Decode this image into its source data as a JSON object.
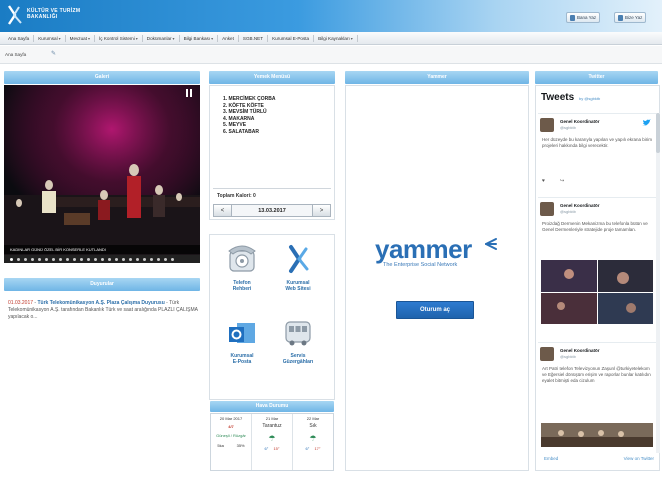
{
  "header": {
    "logo_line1": "KÜLTÜR VE TURİZM",
    "logo_line2": "BAKANLIĞI",
    "btn1": "Bana Yaz",
    "btn2": "Bize Yaz"
  },
  "nav": {
    "items": [
      {
        "label": "Ana Sayfa",
        "dropdown": false
      },
      {
        "label": "Kurumsal",
        "dropdown": true
      },
      {
        "label": "Mevzuat",
        "dropdown": true
      },
      {
        "label": "İç Kontrol Sistemi",
        "dropdown": true
      },
      {
        "label": "Dokümanlar",
        "dropdown": true
      },
      {
        "label": "Bilgi Bankası",
        "dropdown": true
      },
      {
        "label": "Anket",
        "dropdown": false
      },
      {
        "label": "SGB.NET",
        "dropdown": false
      },
      {
        "label": "Kurumsal E-Posta",
        "dropdown": false
      },
      {
        "label": "Bilgi Kaynakları",
        "dropdown": true
      }
    ]
  },
  "subnav": {
    "label": "Ana Sayfa",
    "icon": "edit-icon"
  },
  "panels": {
    "video_title": "Galeri",
    "menu_title": "Yemek Menüsü",
    "yammer_title": "Yammer",
    "twitter_title": "Twitter",
    "news_title": "Duyurular",
    "weather_title": "Hava Durumu"
  },
  "video": {
    "caption": "KADINLAR GÜNÜ ÖZEL BİR KONSERLE KUTLANDI",
    "state": "paused"
  },
  "news": {
    "date": "01.03.2017",
    "title": "Türk Telekomünikasyon A.Ş. Plaza Çalışma Duyurusu",
    "body": "- Türk Telekomünikasyon A.Ş. tarafından Bakanlık Türk ve saat aralığında PLAZLI ÇALIŞMA yapılacak o..."
  },
  "menu": {
    "items": [
      "1. MERCİMEK ÇORBA",
      "2. KÖFTE KÖFTE",
      "3. MEVSİM TÜRLÜ",
      "4. MAKARNA",
      "5. MEYVE",
      "6. SALATABAR"
    ],
    "calorie_label": "Toplam Kalori: 0",
    "date": "13.03.2017",
    "prev": "<",
    "next": ">"
  },
  "tiles": [
    {
      "label1": "Telefon",
      "label2": "Rehberi",
      "icon": "phone-icon"
    },
    {
      "label1": "Kurumsal",
      "label2": "Web Sitesi",
      "icon": "logo-icon"
    },
    {
      "label1": "Kurumsal",
      "label2": "E-Posta",
      "icon": "mail-icon"
    },
    {
      "label1": "Servis",
      "label2": "Güzergâhları",
      "icon": "bus-icon"
    }
  ],
  "weather": {
    "today_label": "20 Mar 2017",
    "today_temp": "4/7",
    "today_status": "Güneşli / Rüzgâr",
    "today_wind": "5ka",
    "today_hum": "35%",
    "d2_day": "21 Mar",
    "d2_name": "Tarantuz",
    "d2_lo": "6°",
    "d2_hi": "15°",
    "d3_day": "22 Mar",
    "d3_name": "Sık",
    "d3_lo": "6°",
    "d3_hi": "17°"
  },
  "yammer": {
    "logo": "yammer",
    "tagline": "The Enterprise Social Network",
    "button": "Oturum aç"
  },
  "twitter": {
    "title": "Tweets",
    "by": "by @sgbktb",
    "tweets": [
      {
        "name": "Genel Koordinatör",
        "handle": "@sgbktb",
        "text": "Her düzeyde bu kararıyla yapılan ve yapılı ekrana birim projeleri hakkında bilgi verecektir."
      },
      {
        "name": "Genel Koordinatör",
        "handle": "@sgbktb",
        "text": "Proizdağ Dermenin Mekanizma bu telefonla bütün ve Genel Dermenleriyle stratejide proje tamamlan."
      },
      {
        "name": "Genel Koordinatör",
        "handle": "@sgbktb",
        "text": "Art Patri telefon Televizyonun Zaşunl @turkiyetelekom ve Eğersiel dönüşüm erişim ve raporlar bunlar katılıdın eyalet bitmişti eda cizulum"
      }
    ],
    "embed": "Embed",
    "view_on": "View on Twitter"
  },
  "colors": {
    "accent": "#2a6fb5",
    "panel_header": "#7dbde9",
    "news_date": "#c0392b"
  }
}
